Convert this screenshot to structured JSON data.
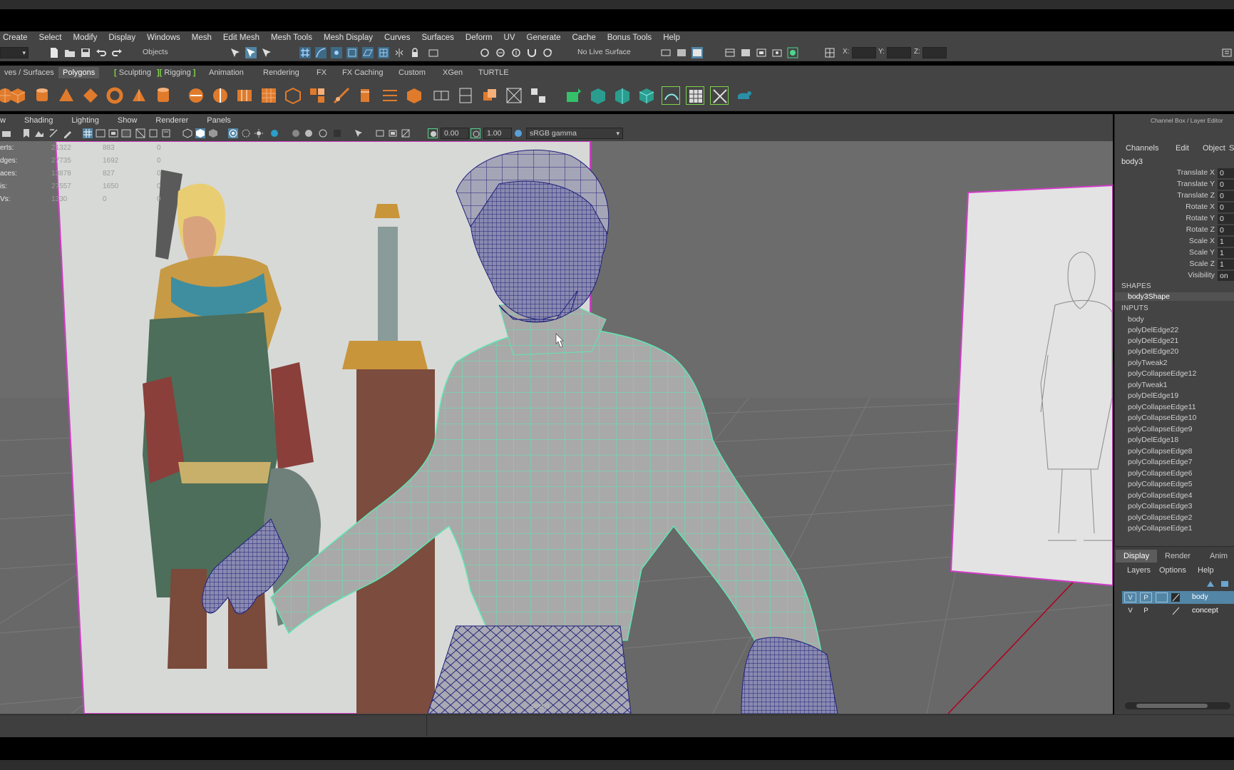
{
  "menubar": {
    "items": [
      "Create",
      "Select",
      "Modify",
      "Display",
      "Windows",
      "Mesh",
      "Edit Mesh",
      "Mesh Tools",
      "Mesh Display",
      "Curves",
      "Surfaces",
      "Deform",
      "UV",
      "Generate",
      "Cache",
      "Bonus Tools",
      "Help"
    ]
  },
  "statusline": {
    "select_mode": "Objects",
    "live_surface": "No Live Surface",
    "x_label": "X:",
    "y_label": "Y:",
    "z_label": "Z:"
  },
  "shelf_tabs": [
    "ves / Surfaces",
    "Polygons",
    "Sculpting",
    "Rigging",
    "Animation",
    "Rendering",
    "FX",
    "FX Caching",
    "Custom",
    "XGen",
    "TURTLE"
  ],
  "shelf_active_tab": "Polygons",
  "panel_menu": [
    "w",
    "Shading",
    "Lighting",
    "Show",
    "Renderer",
    "Panels"
  ],
  "panel_tools": {
    "exposure": "0.00",
    "gamma": "1.00",
    "color_space": "sRGB gamma"
  },
  "hud": {
    "rows": [
      {
        "label": "erts:",
        "v1": "21322",
        "v2": "883",
        "v3": "0"
      },
      {
        "label": "dges:",
        "v1": "27735",
        "v2": "1692",
        "v3": "0"
      },
      {
        "label": "aces:",
        "v1": "13878",
        "v2": "827",
        "v3": "0"
      },
      {
        "label": "is:",
        "v1": "27557",
        "v2": "1650",
        "v3": "0"
      },
      {
        "label": "Vs:",
        "v1": "1330",
        "v2": "0",
        "v3": "0"
      }
    ]
  },
  "camera_label": "persp",
  "channel_box": {
    "title": "Channel Box / Layer Editor",
    "menus": [
      "Channels",
      "Edit",
      "Object",
      "Sh"
    ],
    "object": "body3",
    "attributes": [
      {
        "name": "Translate X",
        "value": "0"
      },
      {
        "name": "Translate Y",
        "value": "0"
      },
      {
        "name": "Translate Z",
        "value": "0"
      },
      {
        "name": "Rotate X",
        "value": "0"
      },
      {
        "name": "Rotate Y",
        "value": "0"
      },
      {
        "name": "Rotate Z",
        "value": "0"
      },
      {
        "name": "Scale X",
        "value": "1"
      },
      {
        "name": "Scale Y",
        "value": "1"
      },
      {
        "name": "Scale Z",
        "value": "1"
      },
      {
        "name": "Visibility",
        "value": "on"
      }
    ],
    "shapes_header": "SHAPES",
    "shape": "body3Shape",
    "inputs_header": "INPUTS",
    "inputs": [
      "body",
      "polyDelEdge22",
      "polyDelEdge21",
      "polyDelEdge20",
      "polyTweak2",
      "polyCollapseEdge12",
      "polyTweak1",
      "polyDelEdge19",
      "polyCollapseEdge11",
      "polyCollapseEdge10",
      "polyCollapseEdge9",
      "polyDelEdge18",
      "polyCollapseEdge8",
      "polyCollapseEdge7",
      "polyCollapseEdge6",
      "polyCollapseEdge5",
      "polyCollapseEdge4",
      "polyCollapseEdge3",
      "polyCollapseEdge2",
      "polyCollapseEdge1"
    ]
  },
  "layer_editor": {
    "tabs": [
      "Display",
      "Render",
      "Anim"
    ],
    "menus": [
      "Layers",
      "Options",
      "Help"
    ],
    "layers": [
      {
        "v": "V",
        "p": "P",
        "name": "body",
        "selected": true
      },
      {
        "v": "V",
        "p": "P",
        "name": "concept",
        "selected": false
      }
    ]
  },
  "colors": {
    "ui_bg": "#444444",
    "wire_selected": "#5fe6b2",
    "wire_unselected": "#1e1e7a",
    "mesh_surface": "#a7a7a7",
    "ref_plane_border": "#d23cc8",
    "layer_selected": "#5285a6"
  }
}
